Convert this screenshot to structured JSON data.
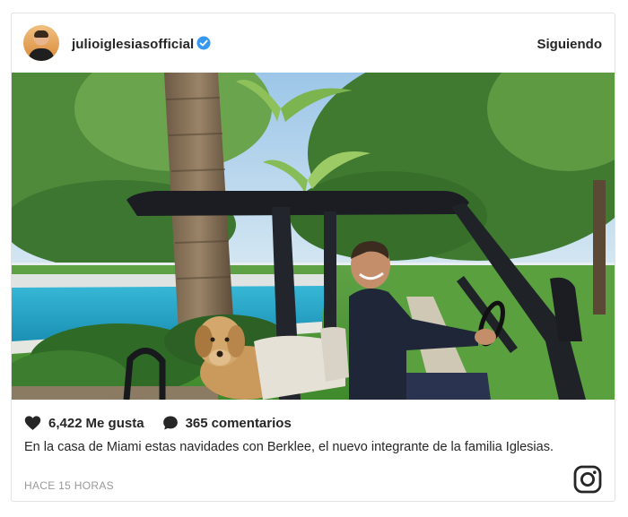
{
  "post": {
    "username": "julioiglesiasofficial",
    "verified": true,
    "follow_status": "Siguiendo",
    "likes_count": "6,422",
    "likes_label": "Me gusta",
    "comments_count": "365",
    "comments_label": "comentarios",
    "caption": "En la casa de Miami estas navidades con Berklee, el nuevo integrante de la familia Iglesias.",
    "time_ago": "HACE 15 HORAS"
  },
  "colors": {
    "text": "#262626",
    "muted": "#999999",
    "verified_badge": "#3897f0",
    "border": "#e2e2e2"
  },
  "icons": {
    "avatar": "profile-photo",
    "verified": "verified-badge-icon",
    "like": "heart-icon",
    "comment": "comment-bubble-icon",
    "brand": "instagram-logo-icon"
  }
}
